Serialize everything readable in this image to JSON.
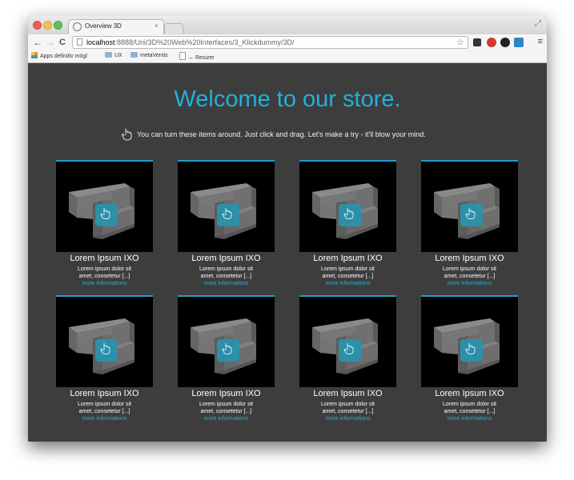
{
  "browser": {
    "tab_title": "Overview 3D",
    "tab_close": "×",
    "url_host": "localhost",
    "url_path": ":8888/Uni/3D%20Web%20Interfaces/3_Klickdummy/3D/",
    "back_glyph": "←",
    "forward_glyph": "→",
    "reload_glyph": "C",
    "star_glyph": "☆",
    "menu_glyph": "≡",
    "bookmarks": [
      {
        "label": "Apps definitiv mögl",
        "icon": "apps-grid-icon"
      },
      {
        "label": "UX",
        "icon": "folder-icon"
      },
      {
        "label": "metaVentis",
        "icon": "folder-icon"
      },
      {
        "label": "↔ Resizer",
        "icon": "page-icon"
      }
    ]
  },
  "store": {
    "heading": "Welcome to our store.",
    "hint": "You can turn these items around. Just click and drag. Let's make a try - it'll blow your mind."
  },
  "products": [
    {
      "name": "Lorem Ipsum IXO",
      "desc_line1": "Lorem ipsum dolor sit",
      "desc_line2": "amet, consetetur [...]",
      "link": "more informations"
    },
    {
      "name": "Lorem Ipsum IXO",
      "desc_line1": "Lorem ipsum dolor sit",
      "desc_line2": "amet, consetetur [...]",
      "link": "more informations"
    },
    {
      "name": "Lorem Ipsum IXO",
      "desc_line1": "Lorem ipsum dolor sit",
      "desc_line2": "amet, consetetur [...]",
      "link": "more informations"
    },
    {
      "name": "Lorem Ipsum IXO",
      "desc_line1": "Lorem ipsum dolor sit",
      "desc_line2": "amet, consetetur [...]",
      "link": "more informations"
    },
    {
      "name": "Lorem Ipsum IXO",
      "desc_line1": "Lorem ipsum dolor sit",
      "desc_line2": "amet, consetetur [...]",
      "link": "more informations"
    },
    {
      "name": "Lorem Ipsum IXO",
      "desc_line1": "Lorem ipsum dolor sit",
      "desc_line2": "amet, consetetur [...]",
      "link": "more informations"
    },
    {
      "name": "Lorem Ipsum IXO",
      "desc_line1": "Lorem ipsum dolor sit",
      "desc_line2": "amet, consetetur [...]",
      "link": "more informations"
    },
    {
      "name": "Lorem Ipsum IXO",
      "desc_line1": "Lorem ipsum dolor sit",
      "desc_line2": "amet, consetetur [...]",
      "link": "more informations"
    }
  ],
  "colors": {
    "accent": "#21b1d8",
    "background": "#3d3d3d",
    "thumb_bg": "#000000",
    "model_gray": "#6f6f6f",
    "drag_badge": "#2e8fa8"
  }
}
